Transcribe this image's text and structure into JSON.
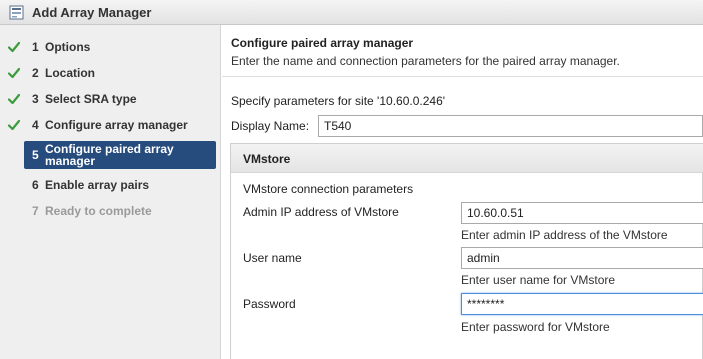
{
  "window": {
    "title": "Add Array Manager",
    "icon": "wizard-icon"
  },
  "steps": [
    {
      "num": "1",
      "label": "Options",
      "state": "done"
    },
    {
      "num": "2",
      "label": "Location",
      "state": "done"
    },
    {
      "num": "3",
      "label": "Select SRA type",
      "state": "done"
    },
    {
      "num": "4",
      "label": "Configure array manager",
      "state": "done"
    },
    {
      "num": "5",
      "label": "Configure paired array manager",
      "state": "active"
    },
    {
      "num": "6",
      "label": "Enable array pairs",
      "state": "pending"
    },
    {
      "num": "7",
      "label": "Ready to complete",
      "state": "disabled"
    }
  ],
  "content": {
    "title": "Configure paired array manager",
    "subtitle": "Enter the name and connection parameters for the paired array manager.",
    "site_text": "Specify parameters for site '10.60.0.246'",
    "display_name_label": "Display Name:",
    "display_name_value": "T540"
  },
  "panel": {
    "title": "VMstore",
    "connection_label": "VMstore connection parameters",
    "fields": [
      {
        "label": "Admin IP address of VMstore",
        "value": "10.60.0.51",
        "hint": "Enter admin IP address of the VMstore"
      },
      {
        "label": "User name",
        "value": "admin",
        "hint": "Enter user name for VMstore"
      },
      {
        "label": "Password",
        "value": "********",
        "hint": "Enter password for VMstore"
      }
    ]
  },
  "colors": {
    "active_step_bg": "#264b7d",
    "check_green": "#3c9b3c",
    "focus_border": "#4a90d9"
  }
}
